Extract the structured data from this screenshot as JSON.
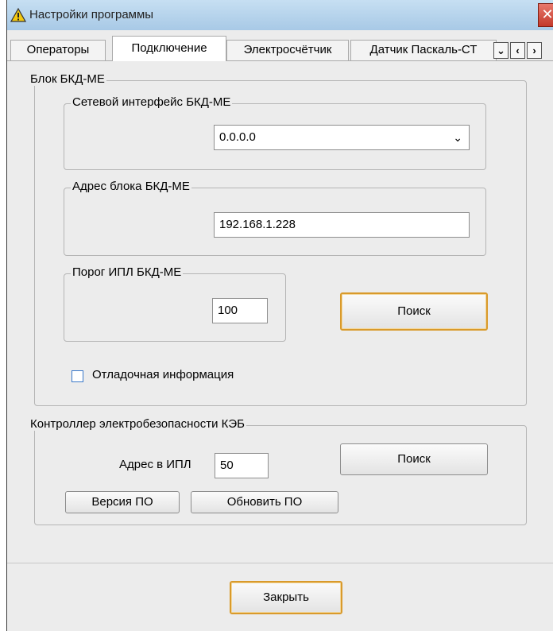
{
  "window": {
    "title": "Настройки программы",
    "close_glyph": "✕"
  },
  "tabs": [
    {
      "label": "Операторы"
    },
    {
      "label": "Подключение"
    },
    {
      "label": "Электросчётчик"
    },
    {
      "label": "Датчик Паскаль-СТ"
    }
  ],
  "tab_scroll": {
    "dropdown": "⌄",
    "left": "‹",
    "right": "›"
  },
  "bkd": {
    "title": "Блок БКД-МЕ",
    "net_interface": {
      "title": "Сетевой интерфейс БКД-МЕ",
      "value": "0.0.0.0",
      "arrow": "⌄"
    },
    "address": {
      "title": "Адрес блока БКД-МЕ",
      "value": "192.168.1.228"
    },
    "threshold": {
      "title": "Порог ИПЛ БКД-МЕ",
      "value": "100"
    },
    "search_label": "Поиск",
    "debug_label": "Отладочная информация"
  },
  "keb": {
    "title": "Контроллер электробезопасности КЭБ",
    "address_label": "Адрес в ИПЛ",
    "address_value": "50",
    "search_label": "Поиск",
    "version_label": "Версия ПО",
    "update_label": "Обновить ПО"
  },
  "footer": {
    "close_label": "Закрыть"
  },
  "colors": {
    "focus_border": "#d99a2b",
    "checkbox_border": "#3a78c9",
    "close_red": "#c3392b"
  }
}
